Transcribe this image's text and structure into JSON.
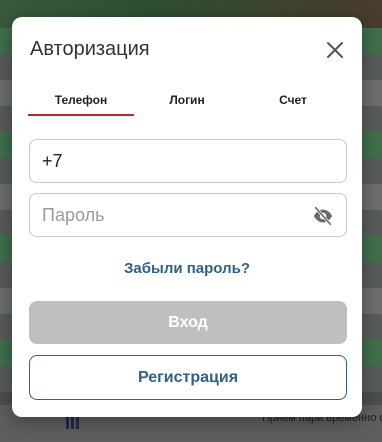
{
  "modal": {
    "title": "Авторизация",
    "close_icon": "close-icon"
  },
  "tabs": [
    {
      "label": "Телефон",
      "active": true
    },
    {
      "label": "Логин",
      "active": false
    },
    {
      "label": "Счет",
      "active": false
    }
  ],
  "phone_field": {
    "value": "+7"
  },
  "password_field": {
    "placeholder": "Пароль",
    "toggle_icon": "eye-off-icon"
  },
  "forgot_link": "Забыли пароль?",
  "login_button": "Вход",
  "register_button": "Регистрация",
  "background": {
    "bottom_note": "Прием пари временно о"
  },
  "colors": {
    "accent_red": "#c0262d",
    "link_blue": "#2f6386",
    "disabled_gray": "#bfbfbf"
  }
}
